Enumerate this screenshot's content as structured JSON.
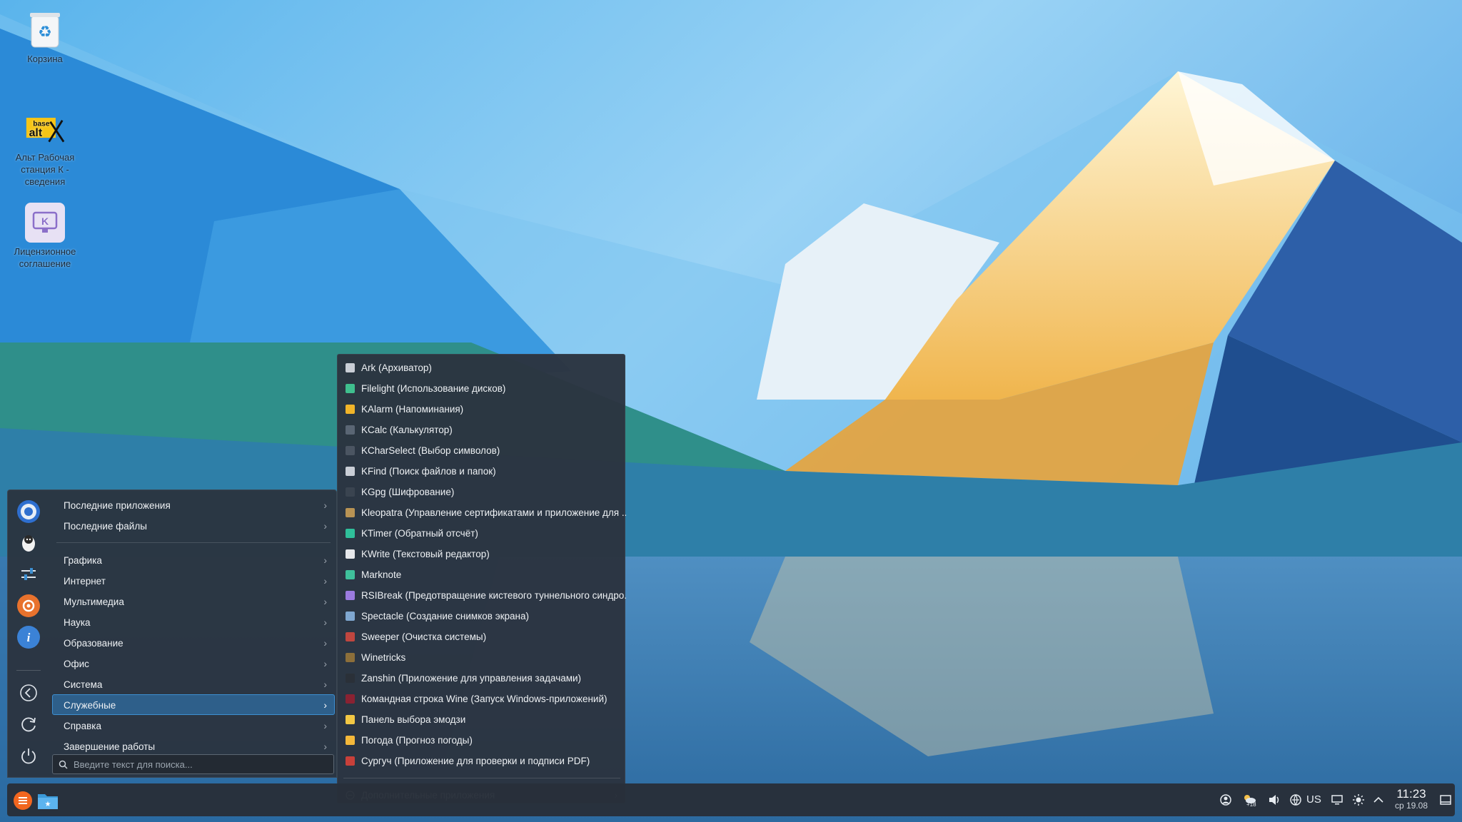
{
  "desktop": {
    "icons": [
      {
        "label": "Корзина",
        "icon": "trash-icon"
      },
      {
        "label": "Альт Рабочая станция К - сведения",
        "icon": "basealt-logo-icon"
      },
      {
        "label": "Лицензионное соглашение",
        "icon": "license-icon"
      }
    ]
  },
  "menu": {
    "categories": [
      "Последние приложения",
      "Последние файлы",
      "Графика",
      "Интернет",
      "Мультимедиа",
      "Наука",
      "Образование",
      "Офис",
      "Система",
      "Служебные",
      "Справка",
      "Завершение работы"
    ],
    "active_category": "Служебные",
    "search_placeholder": "Введите текст для поиска...",
    "rail_icons": [
      "chromium-icon",
      "penguin-icon",
      "settings-sliders-icon",
      "ubuntu-style-icon",
      "info-icon",
      "back-icon",
      "refresh-icon",
      "power-icon"
    ]
  },
  "submenu": {
    "apps": [
      {
        "label": "Ark (Архиватор)",
        "icon": "archive-icon",
        "color": "#c9ced6"
      },
      {
        "label": "Filelight (Использование дисков)",
        "icon": "disk-usage-icon",
        "color": "#3fbf8e"
      },
      {
        "label": "KAlarm (Напоминания)",
        "icon": "bell-icon",
        "color": "#f0b429"
      },
      {
        "label": "KCalc (Калькулятор)",
        "icon": "calculator-icon",
        "color": "#5a6674"
      },
      {
        "label": "KCharSelect (Выбор символов)",
        "icon": "charselect-icon",
        "color": "#4b5562"
      },
      {
        "label": "KFind (Поиск файлов и папок)",
        "icon": "search-icon",
        "color": "#c9ced6"
      },
      {
        "label": "KGpg (Шифрование)",
        "icon": "key-icon",
        "color": "#3a4450"
      },
      {
        "label": "Kleopatra (Управление сертификатами и приложение для ...",
        "icon": "certificate-icon",
        "color": "#b89354"
      },
      {
        "label": "KTimer (Обратный отсчёт)",
        "icon": "timer-icon",
        "color": "#2fbf9a"
      },
      {
        "label": "KWrite (Текстовый редактор)",
        "icon": "text-editor-icon",
        "color": "#e6e8eb"
      },
      {
        "label": "Marknote",
        "icon": "notes-icon",
        "color": "#3fc09b"
      },
      {
        "label": "RSIBreak (Предотвращение кистевого туннельного синдро...",
        "icon": "rsibreak-icon",
        "color": "#9b7be0"
      },
      {
        "label": "Spectacle (Создание снимков экрана)",
        "icon": "screenshot-icon",
        "color": "#7fa7d0"
      },
      {
        "label": "Sweeper (Очистка системы)",
        "icon": "broom-icon",
        "color": "#c0463f"
      },
      {
        "label": "Winetricks",
        "icon": "winetricks-icon",
        "color": "#8c6f3a"
      },
      {
        "label": "Zanshin (Приложение для управления задачами)",
        "icon": "tasks-icon",
        "color": "#2a3038"
      },
      {
        "label": "Командная строка Wine (Запуск Windows-приложений)",
        "icon": "wine-icon",
        "color": "#8a2232"
      },
      {
        "label": "Панель выбора эмодзи",
        "icon": "emoji-icon",
        "color": "#f2c744"
      },
      {
        "label": "Погода (Прогноз погоды)",
        "icon": "sun-icon",
        "color": "#f4b83a"
      },
      {
        "label": "Сургуч (Приложение для проверки и подписи PDF)",
        "icon": "seal-icon",
        "color": "#c8403a"
      }
    ],
    "more_label": "Дополнительные приложения"
  },
  "taskbar": {
    "launcher_icon": "app-launcher-icon",
    "pinned": [
      "file-manager-icon"
    ],
    "tray_icons": [
      "vpn-icon",
      "weather-icon",
      "volume-icon",
      "network-icon",
      "display-icon",
      "brightness-icon",
      "expand-tray-icon",
      "show-desktop-icon"
    ],
    "keyboard_layout": "US",
    "weather_temp": "+18",
    "time": "11:23",
    "date": "ср 19.08"
  },
  "colors": {
    "accent": "#3d8fd1",
    "panel": "#2b3440",
    "launcher": "#f2661f"
  }
}
